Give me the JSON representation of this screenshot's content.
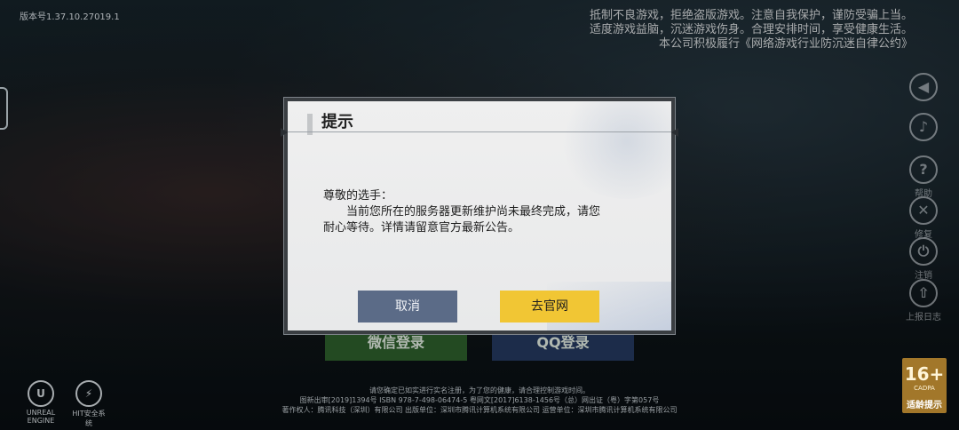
{
  "app": {
    "version": "版本号1.37.10.27019.1",
    "health_notice": [
      "抵制不良游戏，拒绝盗版游戏。注意自我保护，谨防受骗上当。",
      "适度游戏益脑，沉迷游戏伤身。合理安排时间，享受健康生活。",
      "本公司积极履行《网络游戏行业防沉迷自律公约》"
    ]
  },
  "sidebar": {
    "items": [
      {
        "label": "",
        "icon": "notice-icon",
        "glyph": "◀"
      },
      {
        "label": "",
        "icon": "volume-icon",
        "glyph": "🔊"
      },
      {
        "label": "帮助",
        "icon": "help-icon",
        "glyph": "?"
      },
      {
        "label": "修复",
        "icon": "repair-icon",
        "glyph": "✕"
      },
      {
        "label": "注销",
        "icon": "power-icon",
        "glyph": "⏻"
      },
      {
        "label": "上报日志",
        "icon": "upload-log-icon",
        "glyph": "⇧"
      }
    ]
  },
  "login": {
    "wechat_label": "微信登录",
    "qq_label": "QQ登录"
  },
  "footer": {
    "lines": [
      "请您确定已如实进行实名注册，为了您的健康，请合理控制游戏时间。",
      "图新出审[2019]1394号  ISBN 978-7-498-06474-5  粤网文[2017]6138-1456号（总）网出证（粤）字第057号",
      "著作权人：腾讯科技（深圳）有限公司   出版单位：深圳市腾讯计算机系统有限公司   运营单位：深圳市腾讯计算机系统有限公司"
    ],
    "logos": [
      {
        "name": "UNREAL",
        "sub": "ENGINE",
        "icon": "unreal-engine-logo-icon"
      },
      {
        "name": "HIT安全系统",
        "sub": "",
        "icon": "hit-security-logo-icon"
      }
    ],
    "age_rating": {
      "number": "16+",
      "sub": "CADPA",
      "label": "适龄提示"
    }
  },
  "dialog": {
    "title": "提示",
    "greeting": "尊敬的选手：",
    "body_line1": "当前您所在的服务器更新维护尚未最终完成，请您",
    "body_line2": "耐心等待。详情请留意官方最新公告。",
    "cancel_label": "取消",
    "confirm_label": "去官网",
    "colors": {
      "cancel_bg": "#5b6b87",
      "confirm_bg": "#f1c634"
    }
  }
}
